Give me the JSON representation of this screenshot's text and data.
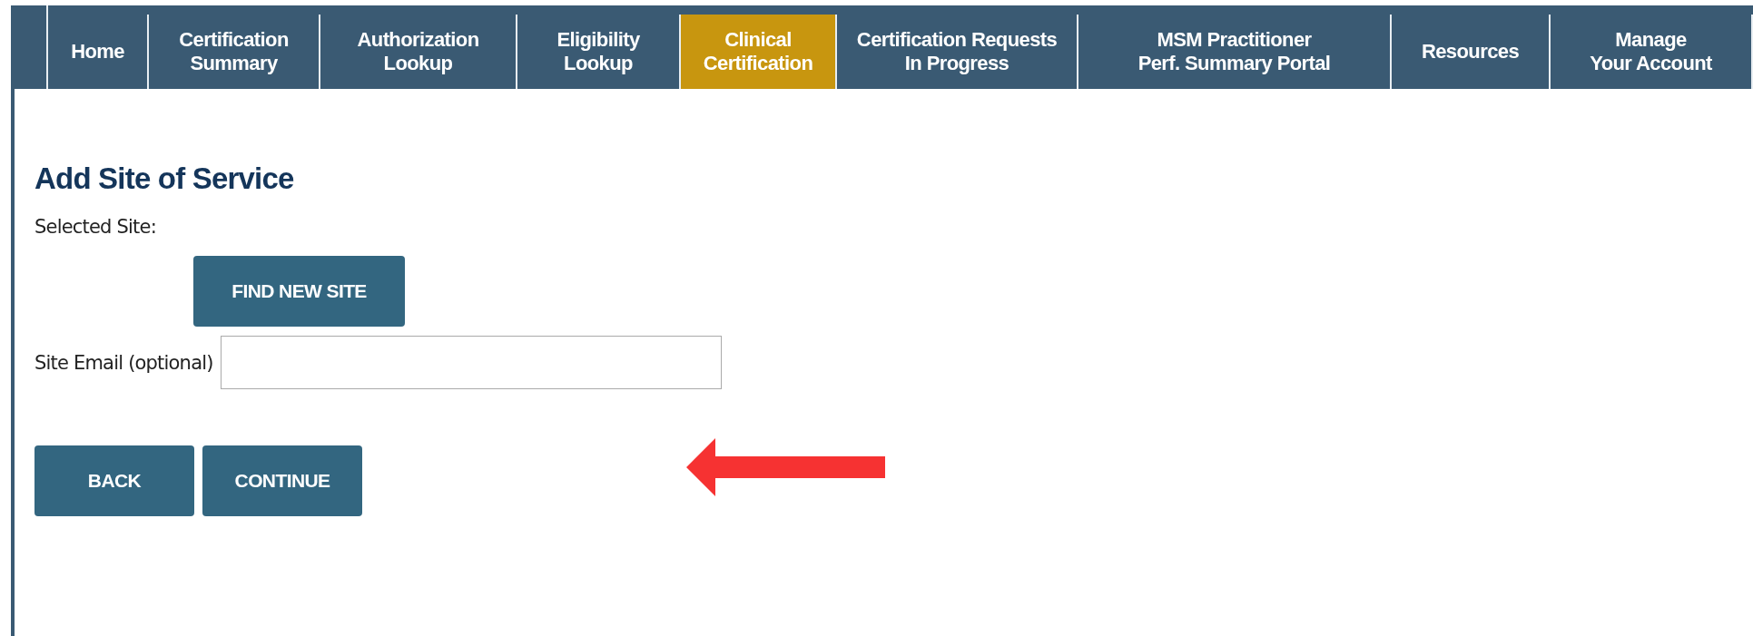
{
  "nav": {
    "tabs": [
      {
        "label": "Home",
        "selected": false
      },
      {
        "label": "Certification\nSummary",
        "selected": false
      },
      {
        "label": "Authorization\nLookup",
        "selected": false
      },
      {
        "label": "Eligibility\nLookup",
        "selected": false
      },
      {
        "label": "Clinical\nCertification",
        "selected": true
      },
      {
        "label": "Certification Requests\nIn Progress",
        "selected": false
      },
      {
        "label": "MSM Practitioner\nPerf. Summary Portal",
        "selected": false
      },
      {
        "label": "Resources",
        "selected": false
      },
      {
        "label": "Manage\nYour Account",
        "selected": false
      }
    ]
  },
  "form": {
    "title": "Add Site of Service",
    "selected_site_label": "Selected Site:",
    "find_button": "FIND NEW SITE",
    "email_label": "Site Email (optional)",
    "buttons": [
      "BACK",
      "CONTINUE"
    ]
  }
}
